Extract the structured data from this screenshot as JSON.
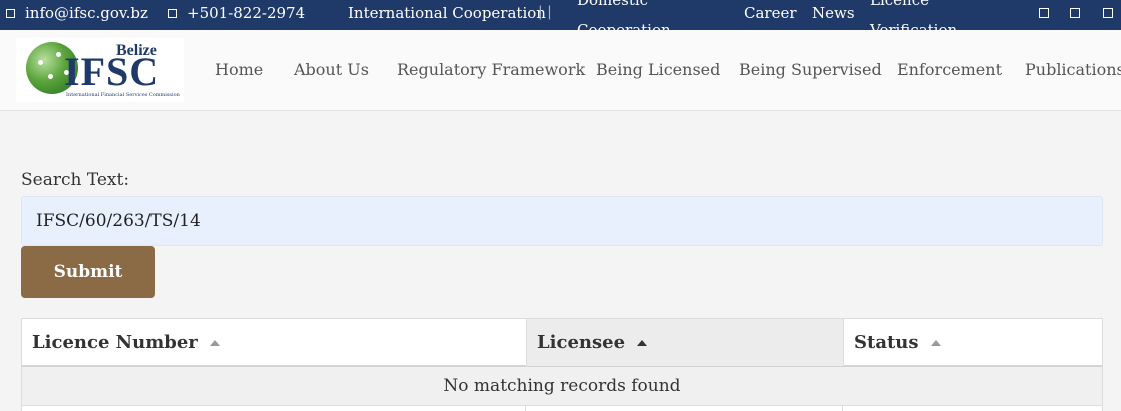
{
  "topbar": {
    "email": "info@ifsc.gov.bz",
    "phone": "+501-822-2974",
    "international": "International Cooperation",
    "separator": "| |",
    "domestic": "Domestic Cooperation",
    "career": "Career",
    "news": "News",
    "licence_verification": "Licence Verification",
    "icons": [
      "email-icon",
      "phone-icon",
      "social-icon",
      "social-icon",
      "social-icon"
    ]
  },
  "logo": {
    "belize": "Belize",
    "ifsc": "IFSC",
    "tagline": "International Financial Services Commission"
  },
  "nav": {
    "items": [
      "Home",
      "About Us",
      "Regulatory Framework",
      "Being Licensed",
      "Being Supervised",
      "Enforcement",
      "Publications"
    ]
  },
  "search": {
    "label": "Search Text:",
    "value": "IFSC/60/263/TS/14",
    "submit": "Submit"
  },
  "table": {
    "columns": [
      "Licence Number",
      "Licensee",
      "Status"
    ],
    "sorted_column": "Licensee",
    "empty_message": "No matching records found"
  },
  "colors": {
    "topbar": "#1f3a69",
    "submit": "#8b6b46",
    "search_bg": "#e8f0fe"
  }
}
